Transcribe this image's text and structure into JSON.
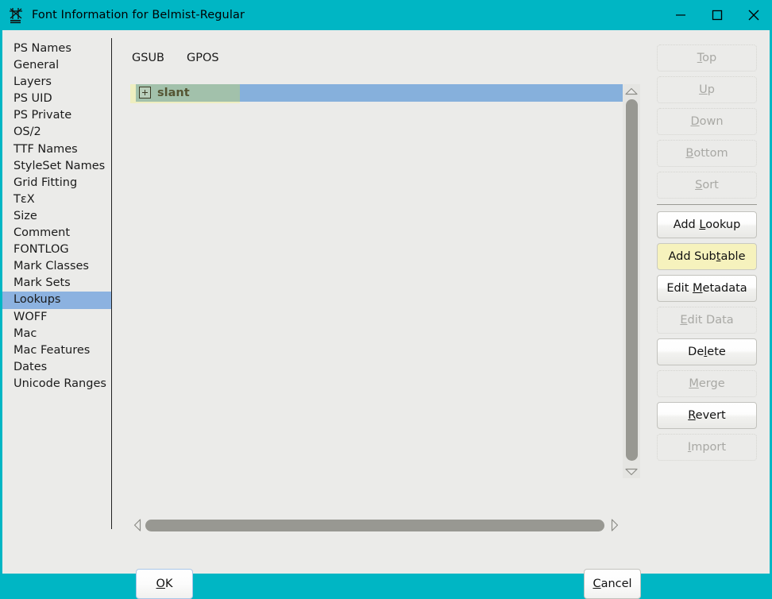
{
  "window": {
    "title": "Font Information for Belmist-Regular",
    "icon": "fontforge-glyph-icon",
    "accent_color": "#00b6c4",
    "background_color": "#ebebe9",
    "controls": {
      "minimize": "minimize-icon",
      "maximize": "maximize-icon",
      "close": "close-icon"
    }
  },
  "sidebar": {
    "selected": "Lookups",
    "selection_color": "#8cb2e0",
    "items": [
      {
        "label": "PS Names"
      },
      {
        "label": "General"
      },
      {
        "label": "Layers"
      },
      {
        "label": "PS UID"
      },
      {
        "label": "PS Private"
      },
      {
        "label": "OS/2"
      },
      {
        "label": "TTF Names"
      },
      {
        "label": "StyleSet Names"
      },
      {
        "label": "Grid Fitting"
      },
      {
        "label": "TεX"
      },
      {
        "label": "Size"
      },
      {
        "label": "Comment"
      },
      {
        "label": "FONTLOG"
      },
      {
        "label": "Mark Classes"
      },
      {
        "label": "Mark Sets"
      },
      {
        "label": "Lookups"
      },
      {
        "label": "WOFF"
      },
      {
        "label": "Mac"
      },
      {
        "label": "Mac Features"
      },
      {
        "label": "Dates"
      },
      {
        "label": "Unicode Ranges"
      }
    ]
  },
  "main": {
    "tabs": [
      {
        "label": "GSUB",
        "active": true
      },
      {
        "label": "GPOS",
        "active": false
      }
    ],
    "list": {
      "rows": [
        {
          "label": "slant",
          "expander": "plus-expander-icon",
          "expanded": false,
          "selected": true,
          "row_highlight_color": "#86b0dc",
          "cell_highlight_color": "#a2c1ab",
          "focus_color": "#eeeec0"
        }
      ]
    },
    "vscrollbar": {
      "up": "scroll-up-arrow-icon",
      "down": "scroll-down-arrow-icon",
      "thumb_color": "#989892"
    },
    "hscrollbar": {
      "left": "scroll-left-arrow-icon",
      "right": "scroll-right-arrow-icon",
      "thumb_color": "#989892"
    }
  },
  "buttons": {
    "top": {
      "label": "Top",
      "mnemonic": "T",
      "enabled": false
    },
    "up": {
      "label": "Up",
      "mnemonic": "U",
      "enabled": false
    },
    "down": {
      "label": "Down",
      "mnemonic": "D",
      "enabled": false
    },
    "bottom": {
      "label": "Bottom",
      "mnemonic": "B",
      "enabled": false
    },
    "sort": {
      "label": "Sort",
      "mnemonic": "S",
      "enabled": false
    },
    "add_lookup": {
      "label": "Add Lookup",
      "mnemonic": "L",
      "enabled": true
    },
    "add_subtable": {
      "label": "Add Subtable",
      "mnemonic": "t",
      "enabled": true,
      "highlighted": true,
      "highlight_color": "#f6f2bd"
    },
    "edit_metadata": {
      "label": "Edit Metadata",
      "mnemonic": "M",
      "enabled": true
    },
    "edit_data": {
      "label": "Edit Data",
      "mnemonic": "E",
      "enabled": false
    },
    "delete": {
      "label": "Delete",
      "mnemonic": "l",
      "enabled": true
    },
    "merge": {
      "label": "Merge",
      "mnemonic": "M",
      "enabled": false
    },
    "revert": {
      "label": "Revert",
      "mnemonic": "R",
      "enabled": true
    },
    "import": {
      "label": "Import",
      "mnemonic": "I",
      "enabled": false
    }
  },
  "footer": {
    "ok": {
      "label": "OK",
      "mnemonic": "O",
      "default": true
    },
    "cancel": {
      "label": "Cancel",
      "mnemonic": "C",
      "default": false
    }
  }
}
